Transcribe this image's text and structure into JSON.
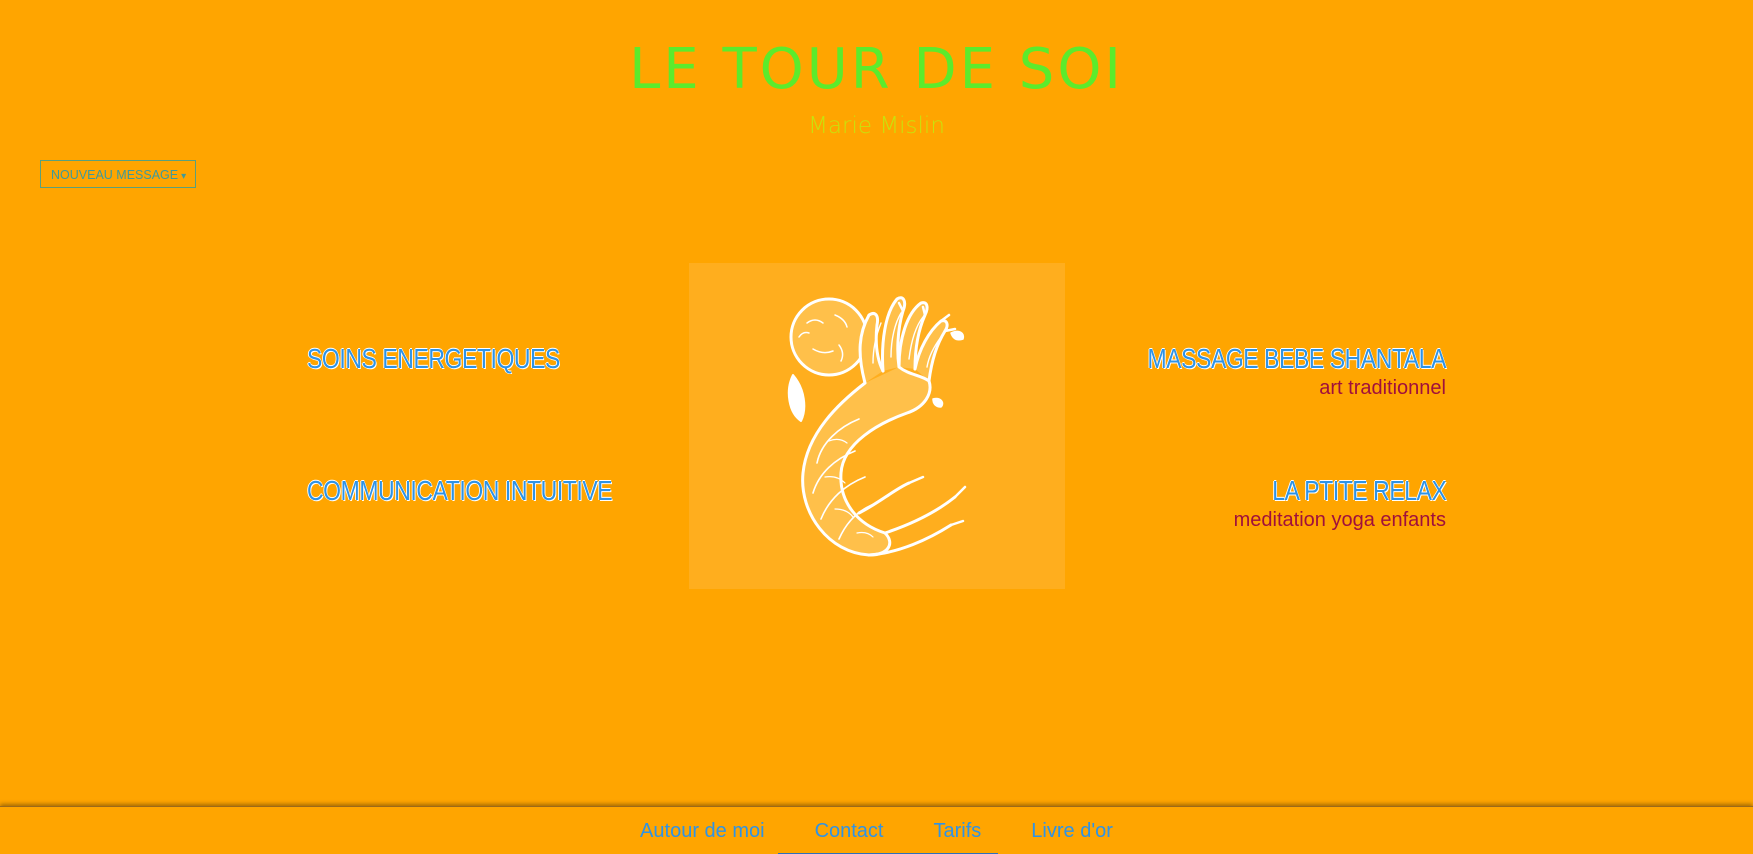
{
  "header": {
    "title": "LE TOUR DE SOI",
    "subtitle": "Marie Mislin"
  },
  "toolbar": {
    "new_message_label": "NOUVEAU MESSAGE",
    "new_message_caret": "▾"
  },
  "services": {
    "soins": {
      "title": "SOINS ENERGETIQUES"
    },
    "communication": {
      "title": "COMMUNICATION INTUITIVE"
    },
    "massage": {
      "title": "MASSAGE BEBE SHANTALA",
      "subtitle": "art traditionnel"
    },
    "relax": {
      "title": "LA PTITE RELAX",
      "subtitle": "meditation yoga enfants"
    }
  },
  "center_image": {
    "icon": "tree-hand-moon-logo-icon"
  },
  "footer": {
    "nav": [
      {
        "label": "Autour de moi"
      },
      {
        "label": "Contact"
      },
      {
        "label": "Tarifs"
      },
      {
        "label": "Livre d'or"
      }
    ]
  },
  "colors": {
    "background": "#FFA500",
    "title": "#5CEB2C",
    "subtitle": "#C9E20C",
    "service_title": "#2E93E6",
    "service_sub": "#A0103C",
    "footer_link": "#2E93E6"
  }
}
